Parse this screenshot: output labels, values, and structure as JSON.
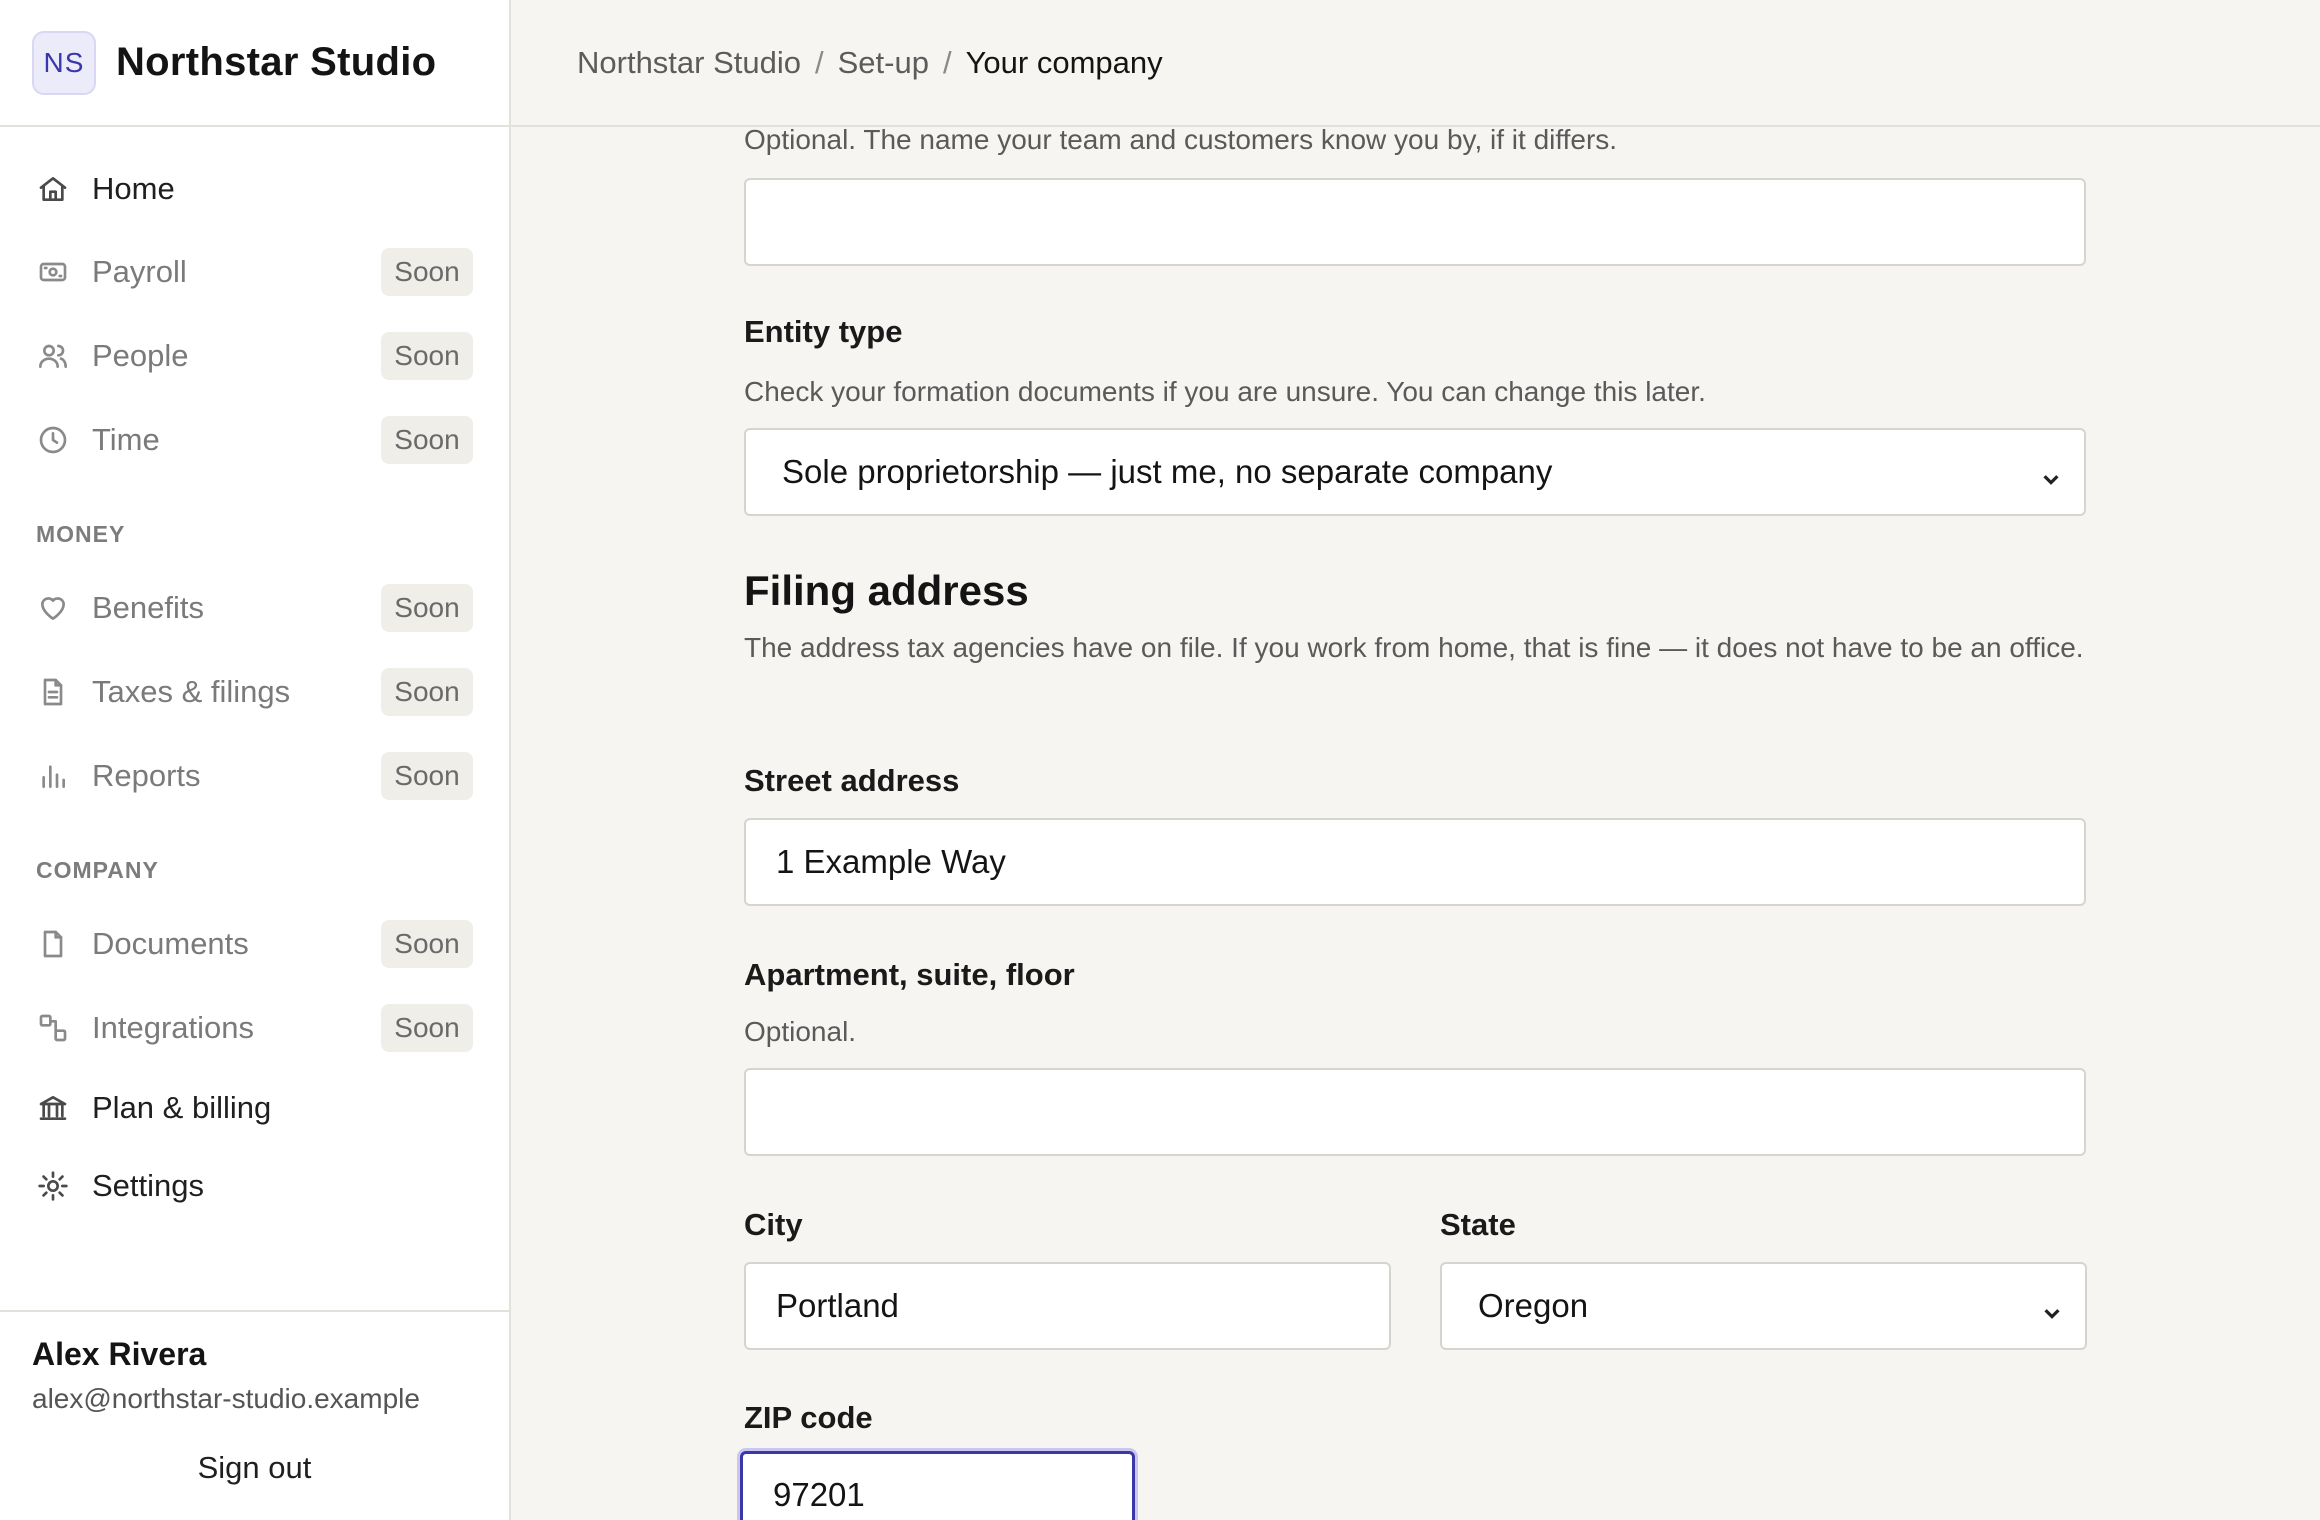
{
  "brand": {
    "initials": "NS",
    "name": "Northstar Studio"
  },
  "breadcrumb": {
    "items": [
      "Northstar Studio",
      "Set-up",
      "Your company"
    ],
    "separator": "/"
  },
  "sidebar": {
    "items": [
      {
        "label": "Home",
        "icon": "home-icon",
        "badge": ""
      },
      {
        "label": "Payroll",
        "icon": "payroll-icon",
        "badge": "Soon"
      },
      {
        "label": "People",
        "icon": "people-icon",
        "badge": "Soon"
      },
      {
        "label": "Time",
        "icon": "clock-icon",
        "badge": "Soon"
      },
      {
        "label": "Benefits",
        "icon": "heart-icon",
        "badge": "Soon"
      },
      {
        "label": "Taxes & filings",
        "icon": "document-icon",
        "badge": "Soon"
      },
      {
        "label": "Reports",
        "icon": "bar-chart-icon",
        "badge": "Soon"
      },
      {
        "label": "Documents",
        "icon": "file-icon",
        "badge": "Soon"
      },
      {
        "label": "Integrations",
        "icon": "integrations-icon",
        "badge": "Soon"
      },
      {
        "label": "Plan & billing",
        "icon": "bank-icon",
        "badge": ""
      },
      {
        "label": "Settings",
        "icon": "gear-icon",
        "badge": ""
      }
    ],
    "sections": {
      "money": "MONEY",
      "company": "COMPANY"
    }
  },
  "user": {
    "name": "Alex Rivera",
    "email": "alex@northstar-studio.example",
    "signout": "Sign out"
  },
  "form": {
    "dba": {
      "help": "Optional. The name your team and customers know you by, if it differs.",
      "value": ""
    },
    "entity_type": {
      "label": "Entity type",
      "help": "Check your formation documents if you are unsure. You can change this later.",
      "value": "Sole proprietorship — just me, no separate company"
    },
    "filing_address": {
      "title": "Filing address",
      "help": "The address tax agencies have on file. If you work from home, that is fine — it does not have to be an office."
    },
    "street": {
      "label": "Street address",
      "value": "1 Example Way"
    },
    "apartment": {
      "label": "Apartment, suite, floor",
      "help": "Optional.",
      "value": ""
    },
    "city": {
      "label": "City",
      "value": "Portland"
    },
    "state": {
      "label": "State",
      "value": "Oregon"
    },
    "zip": {
      "label": "ZIP code",
      "value": "97201"
    }
  },
  "colors": {
    "accent": "#3a37a8",
    "background": "#f6f5f2",
    "badge_bg": "#efeee9"
  }
}
